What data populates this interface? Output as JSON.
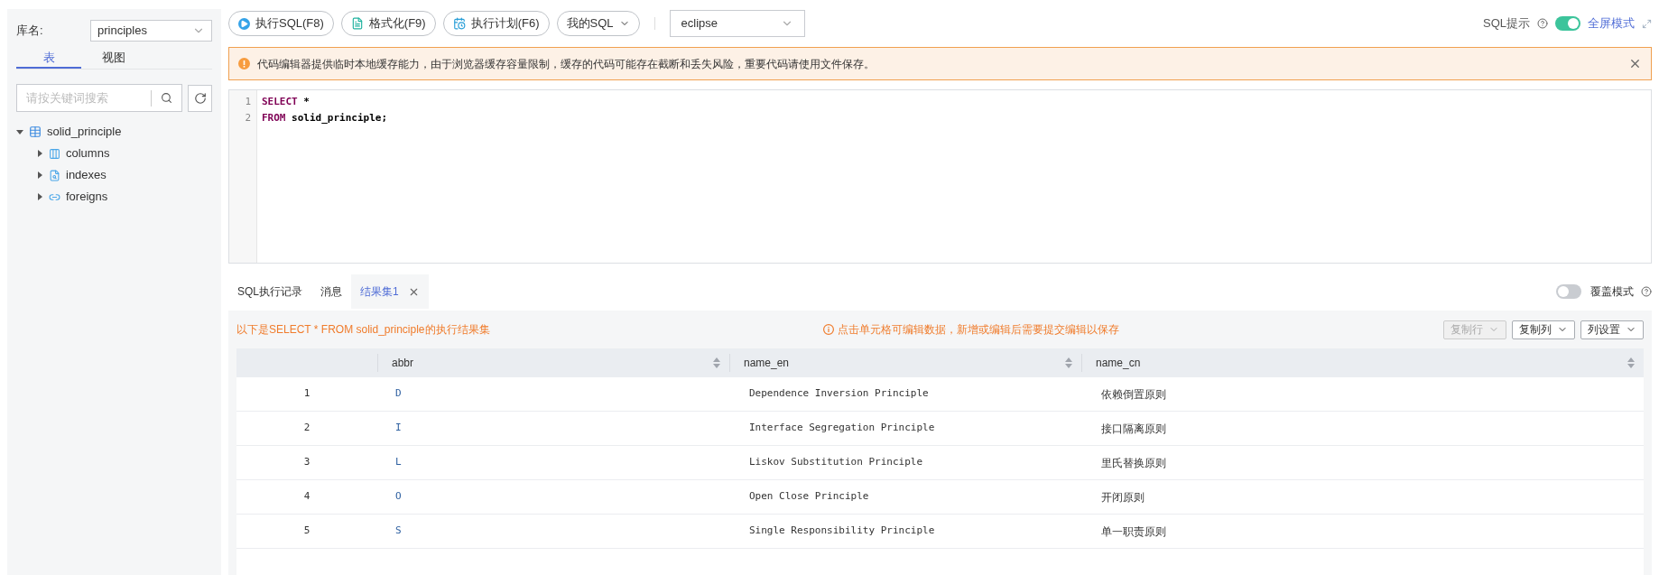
{
  "sidebar": {
    "db_label": "库名:",
    "db_value": "principles",
    "tabs": [
      {
        "label": "表",
        "selected": true
      },
      {
        "label": "视图",
        "selected": false
      }
    ],
    "search": {
      "placeholder": "请按关键词搜索"
    },
    "tree": [
      {
        "label": "solid_principle",
        "kind": "table",
        "expanded": true,
        "children": [
          {
            "label": "columns",
            "kind": "columns",
            "expanded": false
          },
          {
            "label": "indexes",
            "kind": "indexes",
            "expanded": false
          },
          {
            "label": "foreigns",
            "kind": "foreigns",
            "expanded": false
          }
        ]
      }
    ]
  },
  "toolbar": {
    "buttons": [
      {
        "label": "执行SQL(F8)",
        "kind": "run"
      },
      {
        "label": "格式化(F9)",
        "kind": "format"
      },
      {
        "label": "执行计划(F6)",
        "kind": "plan"
      },
      {
        "label": "我的SQL",
        "kind": "menu"
      }
    ],
    "theme": "eclipse",
    "sql_hint": {
      "label": "SQL提示",
      "on": true
    },
    "fullscreen": "全屏模式"
  },
  "alert": "代码编辑器提供临时本地缓存能力，由于浏览器缓存容量限制，缓存的代码可能存在截断和丢失风险，重要代码请使用文件保存。",
  "editor": {
    "lines": [
      {
        "number": "1",
        "tokens": [
          {
            "text": "SELECT",
            "kind": "keyword"
          },
          {
            "text": " *",
            "kind": "text"
          }
        ]
      },
      {
        "number": "2",
        "tokens": [
          {
            "text": "FROM",
            "kind": "keyword"
          },
          {
            "text": " solid_principle;",
            "kind": "text"
          }
        ]
      }
    ]
  },
  "result_tabs": [
    {
      "label": "SQL执行记录",
      "selected": false,
      "closable": false
    },
    {
      "label": "消息",
      "selected": false,
      "closable": false
    },
    {
      "label": "结果集1",
      "selected": true,
      "closable": true
    }
  ],
  "overwrite_mode": {
    "label": "覆盖模式",
    "on": false
  },
  "result": {
    "caption": "以下是SELECT * FROM solid_principle的执行结果集",
    "notice": "点击单元格可编辑数据，新增或编辑后需要提交编辑以保存",
    "actions": [
      {
        "label": "复制行",
        "disabled": true
      },
      {
        "label": "复制列",
        "disabled": false
      },
      {
        "label": "列设置",
        "disabled": false
      }
    ],
    "columns": [
      "",
      "abbr",
      "name_en",
      "name_cn"
    ],
    "rows": [
      [
        "1",
        "D",
        "Dependence Inversion Principle",
        "依赖倒置原则"
      ],
      [
        "2",
        "I",
        "Interface Segregation Principle",
        "接口隔离原则"
      ],
      [
        "3",
        "L",
        "Liskov Substitution Principle",
        "里氏替换原则"
      ],
      [
        "4",
        "O",
        "Open Close Principle",
        "开闭原则"
      ],
      [
        "5",
        "S",
        "Single Responsibility Principle",
        "单一职责原则"
      ]
    ]
  }
}
